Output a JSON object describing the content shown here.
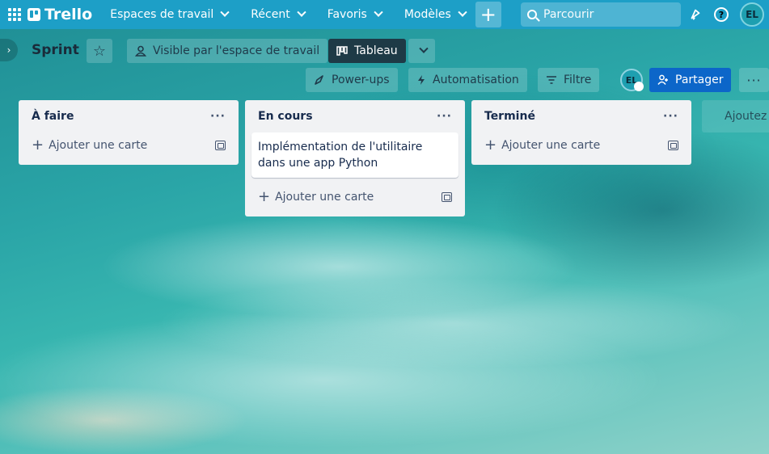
{
  "topnav": {
    "logo_text": "Trello",
    "menus": [
      "Espaces de travail",
      "Récent",
      "Favoris",
      "Modèles"
    ],
    "create_symbol": "+",
    "search_placeholder": "Parcourir",
    "avatar_initials": "EL"
  },
  "board": {
    "title": "Sprint",
    "visibility_label": "Visible par l'espace de travail",
    "view_label": "Tableau",
    "powerups_label": "Power-ups",
    "automation_label": "Automatisation",
    "filter_label": "Filtre",
    "member_initials": "EL",
    "share_label": "Partager",
    "more_label": "···",
    "add_list_label": "Ajoutez"
  },
  "lists": [
    {
      "title": "À faire",
      "cards": [],
      "add_label": "Ajouter une carte"
    },
    {
      "title": "En cours",
      "cards": [
        "Implémentation de l'utilitaire dans une app Python"
      ],
      "add_label": "Ajouter une carte"
    },
    {
      "title": "Terminé",
      "cards": [],
      "add_label": "Ajouter une carte"
    }
  ],
  "icons": {
    "apps": "apps-grid-icon",
    "logo": "trello-logo-icon",
    "search": "search-icon",
    "notifications": "notification-icon",
    "help": "help-icon",
    "star": "star-icon",
    "visibility": "people-icon",
    "view": "board-icon",
    "powerups": "rocket-icon",
    "automation": "lightning-icon",
    "filter": "filter-icon",
    "share": "add-person-icon",
    "template": "card-template-icon"
  },
  "colors": {
    "topnav": "#1d9fc7",
    "share_button": "#0c66c9",
    "view_button": "#1e3a46",
    "list_bg": "#f1f2f4"
  }
}
